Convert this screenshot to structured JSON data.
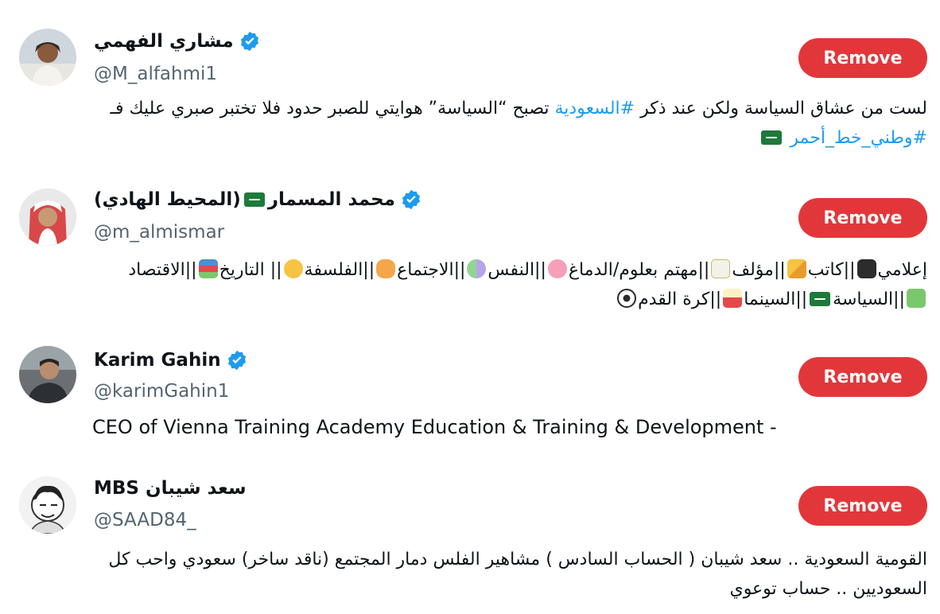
{
  "users": [
    {
      "name": "مشاري الفهمي",
      "handle": "@M_alfahmi1",
      "remove_label": "Remove",
      "bio_line1_a": "لست من عشاق السياسة ولكن عند ذكر ",
      "bio_hashtag1": "#السعودية",
      "bio_line1_b": " تصبح “السياسة” هوايتي للصبر حدود فلا تختبر صبري عليك فـ",
      "bio_hashtag2": "#وطني_خط_أحمر",
      "verified": true
    },
    {
      "name_a": "محمد المسمار",
      "name_b": "(المحيط الهادي)",
      "handle": "@m_almismar",
      "remove_label": "Remove",
      "bio_parts": [
        "إعلامي",
        "||كاتب",
        "||مؤلف",
        "||مهتم بعلوم/الدماغ",
        "||النفس",
        "||الاجتماع",
        "||الفلسفة",
        "|| التاريخ",
        "||الاقتصاد"
      ],
      "bio_line2_parts": [
        "||السياسة",
        "||السينما",
        "||كرة القدم"
      ],
      "verified": true
    },
    {
      "name": "Karim Gahin",
      "handle": "@karimGahin1",
      "remove_label": "Remove",
      "bio": "CEO of Vienna Training Academy Education & Training & Development -",
      "verified": true
    },
    {
      "name": "MBS سعد شيبان",
      "handle": "@SAAD84_",
      "remove_label": "Remove",
      "bio_line1": "القومية السعودية .. سعد شيبان ( الحساب السادس ) مشاهير الفلس دمار المجتمع (ناقد ساخر) سعودي واحب كل",
      "bio_line2": "السعوديين .. حساب توعوي",
      "verified": false
    }
  ],
  "colors": {
    "remove_button": "#e2373a",
    "hashtag": "#1d9bf0",
    "handle": "#536471",
    "verified": "#1d9bf0"
  }
}
